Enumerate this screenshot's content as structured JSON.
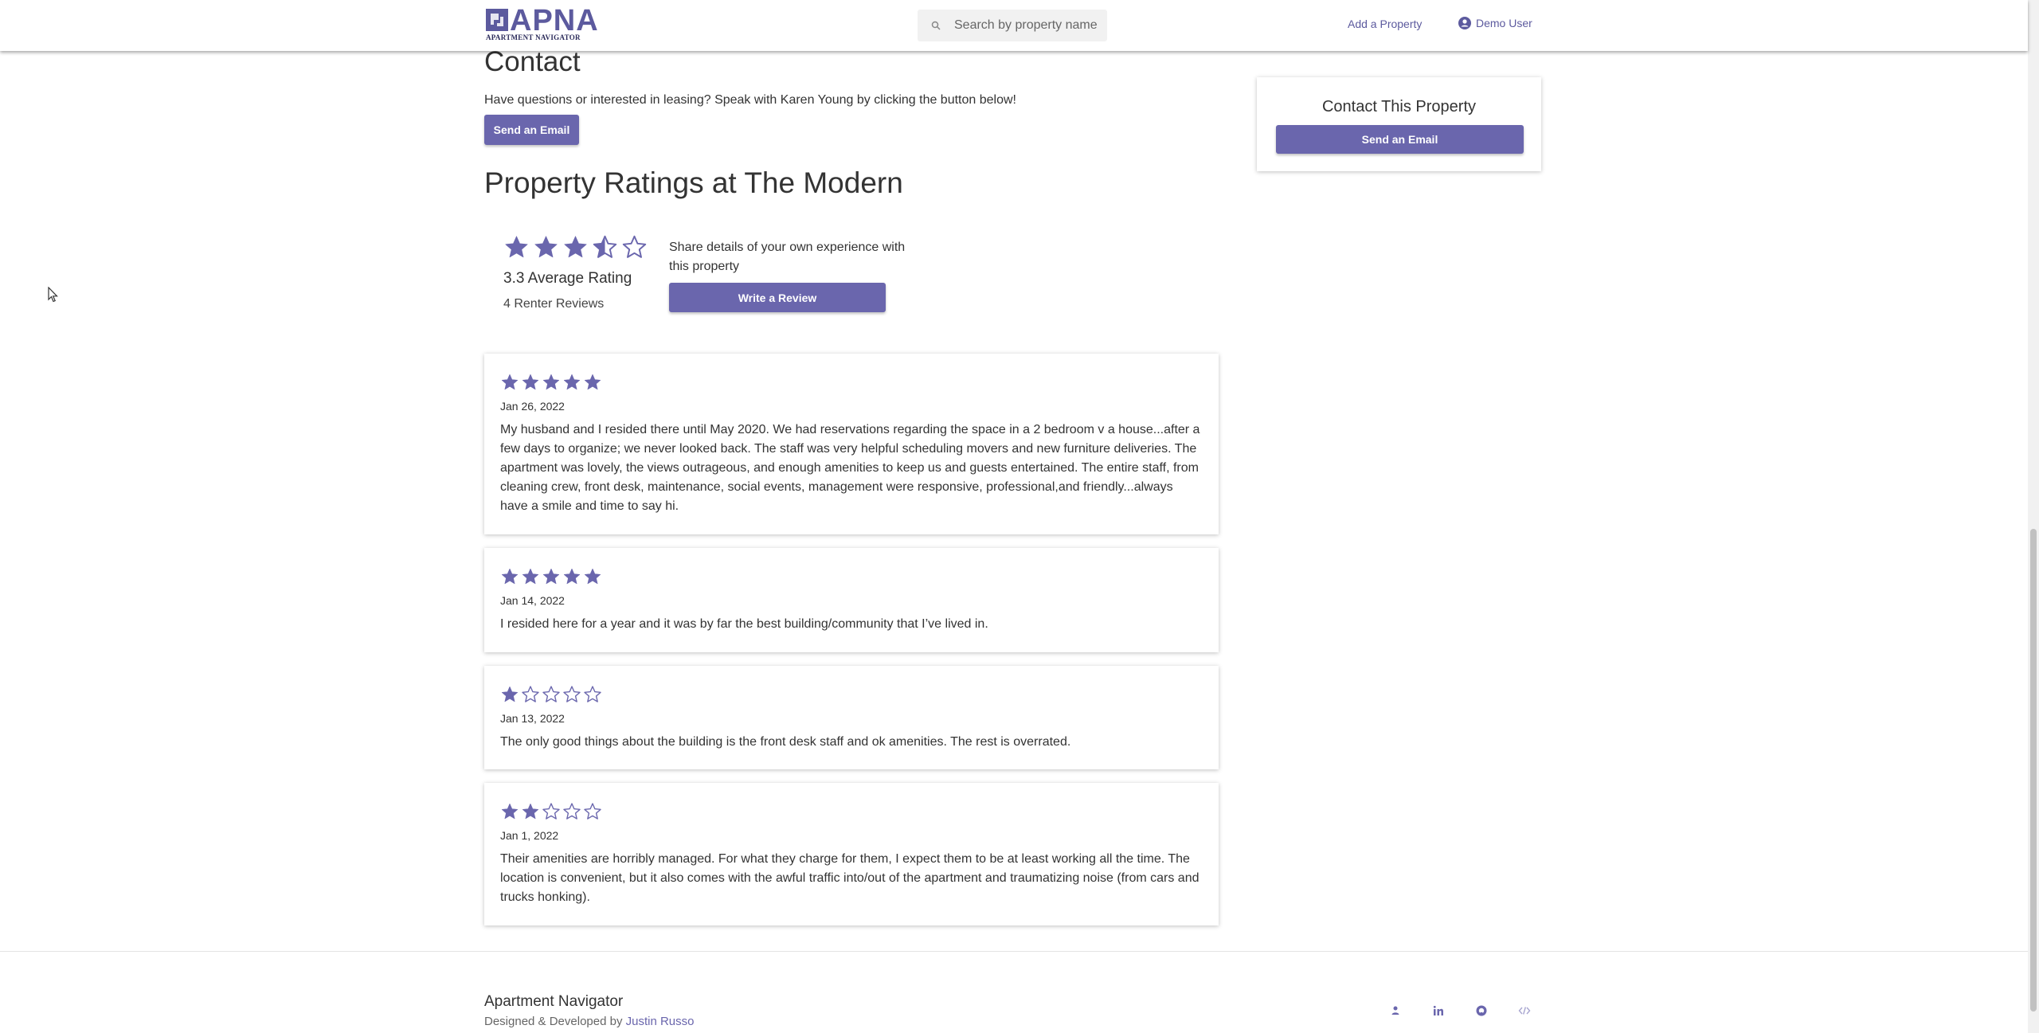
{
  "header": {
    "logo_text": "APNA",
    "logo_sub": "APARTMENT NAVIGATOR",
    "search_placeholder": "Search by property name",
    "add_property": "Add a Property",
    "user_name": "Demo User"
  },
  "contact": {
    "title": "Contact",
    "description": "Have questions or interested in leasing? Speak with Karen Young by clicking the button below!",
    "email_button": "Send an Email"
  },
  "ratings": {
    "title": "Property Ratings at The Modern",
    "average_value": 3.3,
    "average_label": "3.3 Average Rating",
    "count_label": "4 Renter Reviews",
    "share_text": "Share details of your own experience with this property",
    "review_button": "Write a Review"
  },
  "reviews": [
    {
      "rating": 5,
      "date": "Jan 26, 2022",
      "text": "My husband and I resided there until May 2020. We had reservations regarding the space in a 2 bedroom v a house...after a few days to organize; we never looked back. The staff was very helpful scheduling movers and new furniture deliveries. The apartment was lovely, the views outrageous, and enough amenities to keep us and guests entertained. The entire staff, from cleaning crew, front desk, maintenance, social events, management were responsive, professional,and friendly...always have a smile and time to say hi."
    },
    {
      "rating": 5,
      "date": "Jan 14, 2022",
      "text": "I resided here for a year and it was by far the best building/community that I’ve lived in."
    },
    {
      "rating": 1,
      "date": "Jan 13, 2022",
      "text": "The only good things about the building is the front desk staff and ok amenities. The rest is overrated."
    },
    {
      "rating": 2,
      "date": "Jan 1, 2022",
      "text": "Their amenities are horribly managed. For what they charge for them, I expect them to be at least working all the time. The location is convenient, but it also comes with the awful traffic into/out of the apartment and traumatizing noise (from cars and trucks honking)."
    }
  ],
  "sidebar": {
    "title": "Contact This Property",
    "email_button": "Send an Email"
  },
  "footer": {
    "title": "Apartment Navigator",
    "credit_prefix": "Designed & Developed by",
    "credit_name": "Justin Russo",
    "icons": [
      "person-icon",
      "linkedin-icon",
      "github-icon",
      "code-icon"
    ]
  },
  "colors": {
    "accent": "#6a66ad",
    "brand": "#5c5a9e"
  }
}
